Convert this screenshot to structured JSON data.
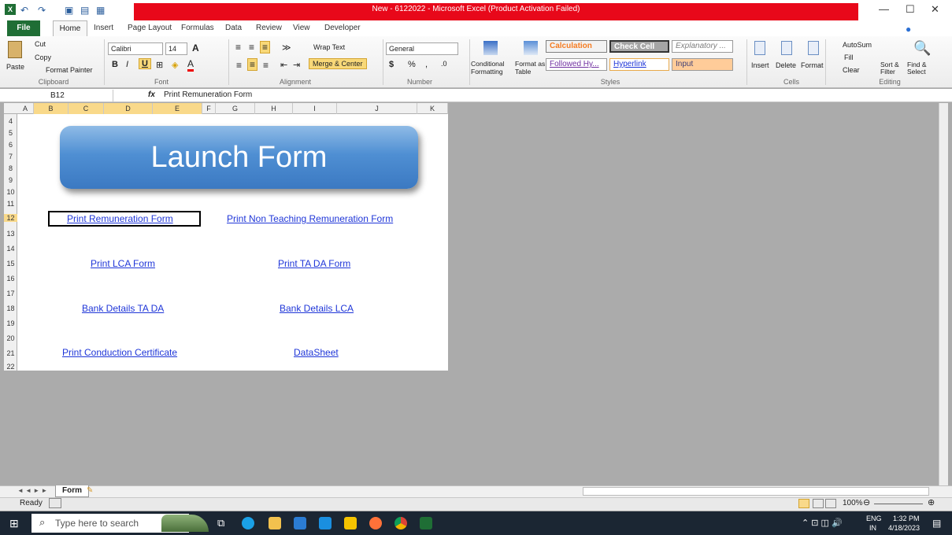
{
  "window": {
    "title": "New - 6122022  -  Microsoft Excel (Product Activation Failed)"
  },
  "ribbon": {
    "tabs": [
      "File",
      "Home",
      "Insert",
      "Page Layout",
      "Formulas",
      "Data",
      "Review",
      "View",
      "Developer"
    ],
    "clipboard": {
      "paste": "Paste",
      "cut": "Cut",
      "copy": "Copy",
      "format_painter": "Format Painter",
      "label": "Clipboard"
    },
    "font": {
      "name": "Calibri",
      "size": "14",
      "label": "Font"
    },
    "alignment": {
      "wrap": "Wrap Text",
      "merge": "Merge & Center",
      "label": "Alignment"
    },
    "number": {
      "format": "General",
      "label": "Number"
    },
    "styles": {
      "cond": "Conditional Formatting",
      "fmt_table": "Format as Table",
      "items": [
        "Calculation",
        "Check Cell",
        "Explanatory ...",
        "Followed Hy...",
        "Hyperlink",
        "Input"
      ],
      "label": "Styles"
    },
    "cells": {
      "insert": "Insert",
      "delete": "Delete",
      "format": "Format",
      "label": "Cells"
    },
    "editing": {
      "autosum": "AutoSum",
      "fill": "Fill",
      "clear": "Clear",
      "sort": "Sort & Filter",
      "find": "Find & Select",
      "label": "Editing"
    }
  },
  "formula_bar": {
    "name_box": "B12",
    "fx": "fx",
    "value": "Print Remuneration Form"
  },
  "sheet": {
    "columns": [
      "A",
      "B",
      "C",
      "D",
      "E",
      "F",
      "G",
      "H",
      "I",
      "J",
      "K"
    ],
    "rows": [
      "4",
      "5",
      "6",
      "7",
      "8",
      "9",
      "10",
      "11",
      "12",
      "13",
      "14",
      "15",
      "16",
      "17",
      "18",
      "19",
      "20",
      "21",
      "22"
    ],
    "launch_button": "Launch Form",
    "links": {
      "remuneration": "Print Remuneration Form",
      "non_teaching": "Print Non Teaching Remuneration Form",
      "lca": "Print LCA Form",
      "tada": "Print TA DA Form",
      "bank_tada": "Bank Details TA DA",
      "bank_lca": "Bank Details LCA",
      "conduction": "Print Conduction Certificate",
      "datasheet": "DataSheet"
    }
  },
  "sheet_tabs": {
    "active": "Form"
  },
  "status": {
    "ready": "Ready",
    "zoom": "100%"
  },
  "taskbar": {
    "search_placeholder": "Type here to search",
    "lang": "ENG",
    "region": "IN",
    "time": "1:32 PM",
    "date": "4/18/2023"
  }
}
